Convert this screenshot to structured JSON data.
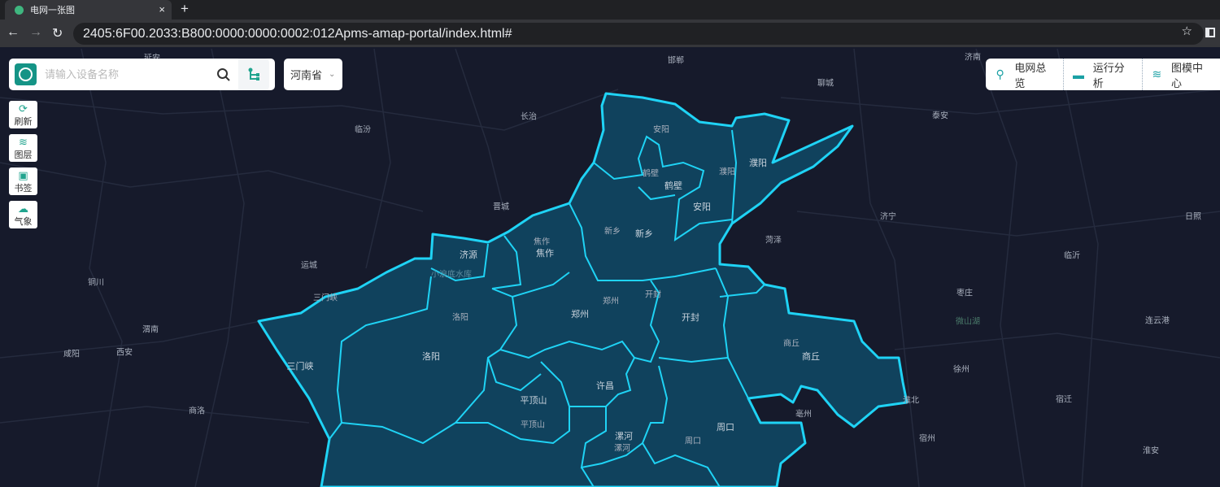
{
  "browser": {
    "tab_title": "电网一张图",
    "new_tab": "+",
    "close": "×",
    "url": "2405:6F00.2033:B800:0000:0000:0002:012Apms-amap-portal/index.html#",
    "back": "←",
    "forward": "→",
    "reload": "↻",
    "star": "☆"
  },
  "search": {
    "placeholder": "请输入设备名称",
    "value": ""
  },
  "province": {
    "selected": "河南省",
    "chevron": "⌄"
  },
  "tools": [
    {
      "label": "刷新",
      "icon": "refresh-icon"
    },
    {
      "label": "图层",
      "icon": "layers-icon"
    },
    {
      "label": "书签",
      "icon": "bookmark-icon"
    },
    {
      "label": "气象",
      "icon": "weather-icon"
    }
  ],
  "topnav": [
    {
      "label": "电网总览",
      "icon": "map-pin-icon"
    },
    {
      "label": "运行分析",
      "icon": "monitor-chart-icon"
    },
    {
      "label": "图模中心",
      "icon": "layers-icon"
    }
  ],
  "colors": {
    "accent": "#20a48e",
    "boundary": "#1fd3f5",
    "fill": "#0f4a66",
    "background": "#161a2b"
  },
  "map": {
    "outside_labels": [
      "延安",
      "邯郸",
      "济南",
      "聊城",
      "泰安",
      "长治",
      "临汾",
      "晋城",
      "济宁",
      "菏泽",
      "日照",
      "临沂",
      "运城",
      "铜川",
      "三门峡",
      "枣庄",
      "渭南",
      "咸阳",
      "西安",
      "连云港",
      "徐州",
      "微山湖",
      "商洛",
      "宿迁",
      "宿州",
      "淮北",
      "淮安",
      "亳州"
    ],
    "inside_labels": [
      "安阳",
      "鹤壁",
      "鹤壁",
      "濮阳",
      "濮阳",
      "安阳",
      "新乡",
      "新乡",
      "焦作",
      "焦作",
      "济源",
      "小浪底水库",
      "郑州",
      "郑州",
      "开封",
      "开封",
      "洛阳",
      "洛阳",
      "三门峡",
      "商丘",
      "商丘",
      "许昌",
      "平顶山",
      "平顶山",
      "漯河",
      "漯河",
      "周口",
      "周口"
    ]
  }
}
